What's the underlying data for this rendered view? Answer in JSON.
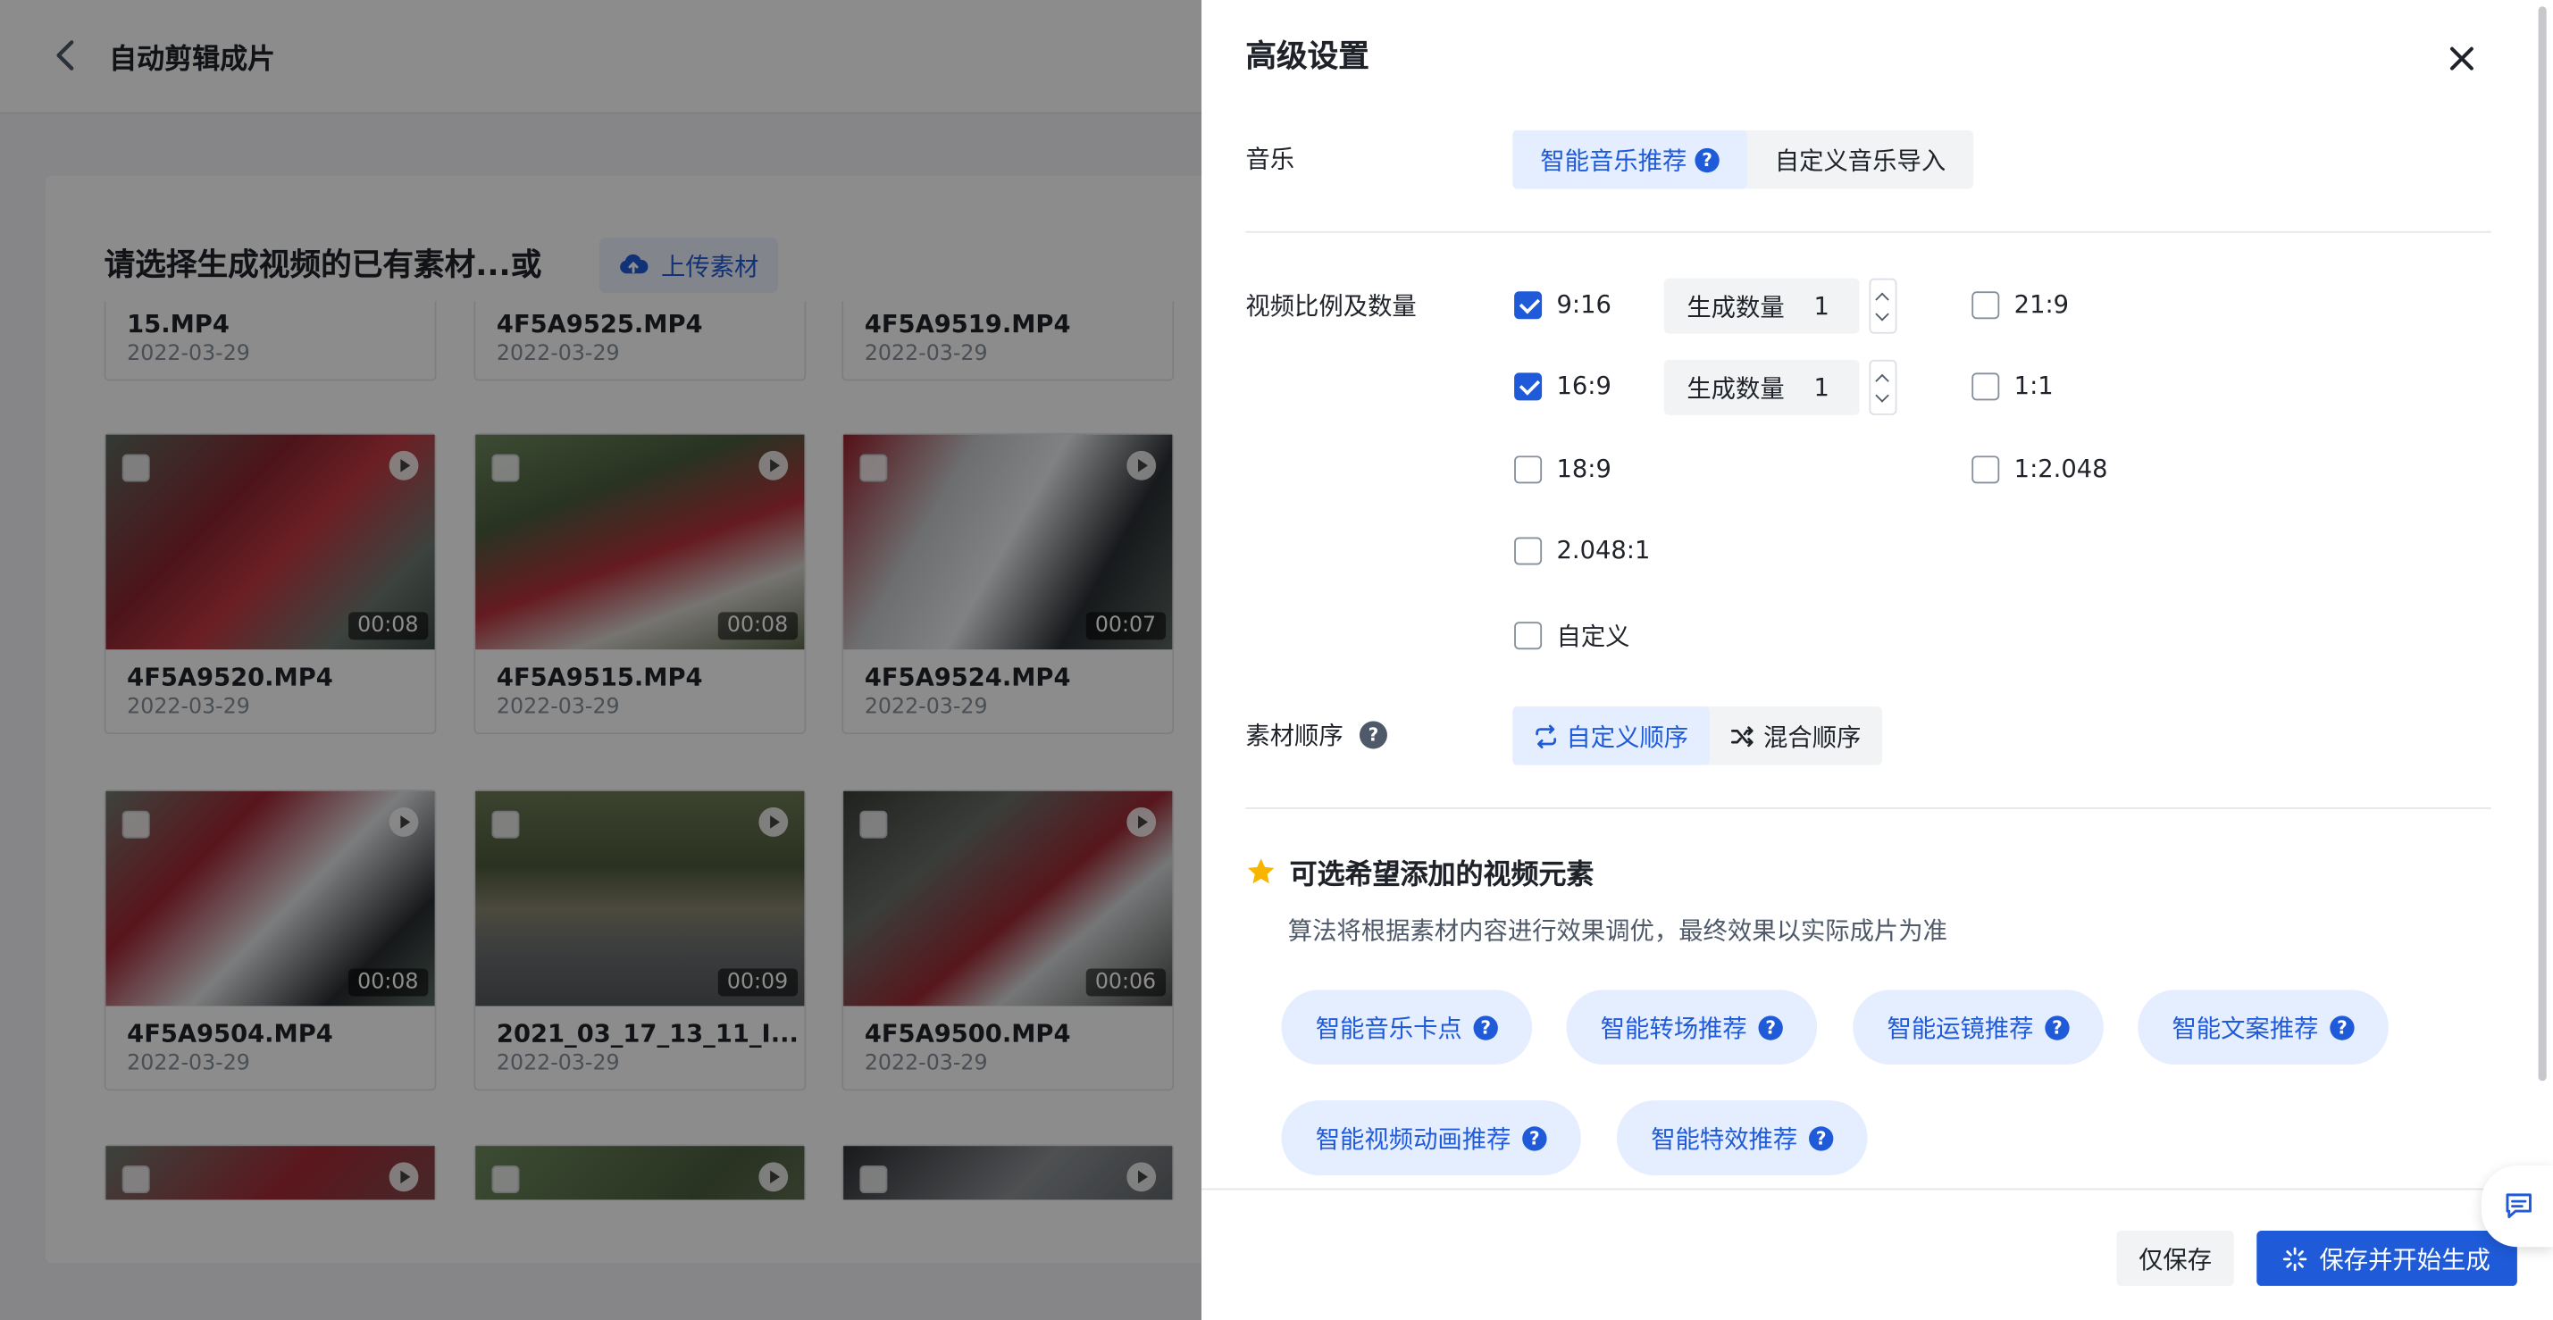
{
  "page": {
    "title": "自动剪辑成片",
    "select_title": "请选择生成视频的已有素材...或",
    "upload_label": "上传素材"
  },
  "videos": [
    {
      "name": "15.MP4",
      "date": "2022-03-29",
      "duration": ""
    },
    {
      "name": "4F5A9525.MP4",
      "date": "2022-03-29",
      "duration": ""
    },
    {
      "name": "4F5A9519.MP4",
      "date": "2022-03-29",
      "duration": ""
    },
    {
      "name": "4F5A9520.MP4",
      "date": "2022-03-29",
      "duration": "00:08"
    },
    {
      "name": "4F5A9515.MP4",
      "date": "2022-03-29",
      "duration": "00:08"
    },
    {
      "name": "4F5A9524.MP4",
      "date": "2022-03-29",
      "duration": "00:07"
    },
    {
      "name": "4F5A9504.MP4",
      "date": "2022-03-29",
      "duration": "00:08"
    },
    {
      "name": "2021_03_17_13_11_I...",
      "date": "2022-03-29",
      "duration": "00:09"
    },
    {
      "name": "4F5A9500.MP4",
      "date": "2022-03-29",
      "duration": "00:06"
    },
    {
      "name": "",
      "date": "",
      "duration": ""
    },
    {
      "name": "",
      "date": "",
      "duration": ""
    },
    {
      "name": "",
      "date": "",
      "duration": ""
    }
  ],
  "drawer": {
    "title": "高级设置",
    "music": {
      "label": "音乐",
      "options": [
        "智能音乐推荐",
        "自定义音乐导入"
      ],
      "selected": "智能音乐推荐"
    },
    "ratio": {
      "label": "视频比例及数量",
      "qty_label": "生成数量",
      "items": [
        {
          "label": "9:16",
          "checked": true,
          "qty": "1"
        },
        {
          "label": "21:9",
          "checked": false
        },
        {
          "label": "16:9",
          "checked": true,
          "qty": "1"
        },
        {
          "label": "1:1",
          "checked": false
        },
        {
          "label": "18:9",
          "checked": false
        },
        {
          "label": "1:2.048",
          "checked": false
        },
        {
          "label": "2.048:1",
          "checked": false
        },
        {
          "label": "自定义",
          "checked": false
        }
      ]
    },
    "order": {
      "label": "素材顺序",
      "options": [
        "自定义顺序",
        "混合顺序"
      ],
      "selected": "自定义顺序"
    },
    "elements": {
      "title": "可选希望添加的视频元素",
      "desc": "算法将根据素材内容进行效果调优，最终效果以实际成片为准",
      "items": [
        "智能音乐卡点",
        "智能转场推荐",
        "智能运镜推荐",
        "智能文案推荐",
        "智能视频动画推荐",
        "智能特效推荐"
      ]
    },
    "footer": {
      "save_only": "仅保存",
      "save_generate": "保存并开始生成"
    }
  },
  "colors": {
    "primary": "#1f5bd8",
    "primary_light": "#e5eeff",
    "overlay": "rgba(0,0,0,0.45)"
  }
}
